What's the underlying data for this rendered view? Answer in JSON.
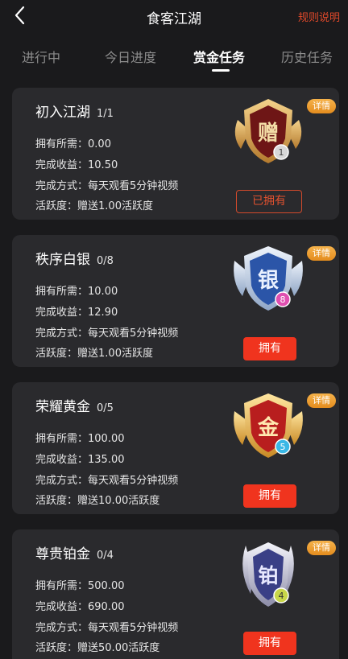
{
  "header": {
    "title": "食客江湖",
    "rules_link": "规则说明"
  },
  "tabs": [
    {
      "label": "进行中",
      "active": false
    },
    {
      "label": "今日进度",
      "active": false
    },
    {
      "label": "赏金任务",
      "active": true
    },
    {
      "label": "历史任务",
      "active": false
    }
  ],
  "labels": {
    "required": "拥有所需：",
    "income": "完成收益：",
    "method": "完成方式：",
    "activity": "活跃度：",
    "detail": "详情"
  },
  "colors": {
    "accent": "#f0341e",
    "link": "#e2492a",
    "detail_tag": "#f0a033",
    "background": "#1a1a1c",
    "card": "#2a2a2d"
  },
  "tasks": [
    {
      "name": "初入江湖",
      "progress": "1/1",
      "required": "0.00",
      "income": "10.50",
      "method": "每天观看5分钟视频",
      "activity": "赠送1.00活跃度",
      "badge_char": "赠",
      "badge_level": "1",
      "badge_icon": "bronze-badge-icon",
      "button": "已拥有",
      "owned": true
    },
    {
      "name": "秩序白银",
      "progress": "0/8",
      "required": "10.00",
      "income": "12.90",
      "method": "每天观看5分钟视频",
      "activity": "赠送1.00活跃度",
      "badge_char": "银",
      "badge_level": "8",
      "badge_icon": "silver-badge-icon",
      "button": "拥有",
      "owned": false
    },
    {
      "name": "荣耀黄金",
      "progress": "0/5",
      "required": "100.00",
      "income": "135.00",
      "method": "每天观看5分钟视频",
      "activity": "赠送10.00活跃度",
      "badge_char": "金",
      "badge_level": "5",
      "badge_icon": "gold-badge-icon",
      "button": "拥有",
      "owned": false
    },
    {
      "name": "尊贵铂金",
      "progress": "0/4",
      "required": "500.00",
      "income": "690.00",
      "method": "每天观看5分钟视频",
      "activity": "赠送50.00活跃度",
      "badge_char": "铂",
      "badge_level": "4",
      "badge_icon": "platinum-badge-icon",
      "button": "拥有",
      "owned": false
    }
  ]
}
